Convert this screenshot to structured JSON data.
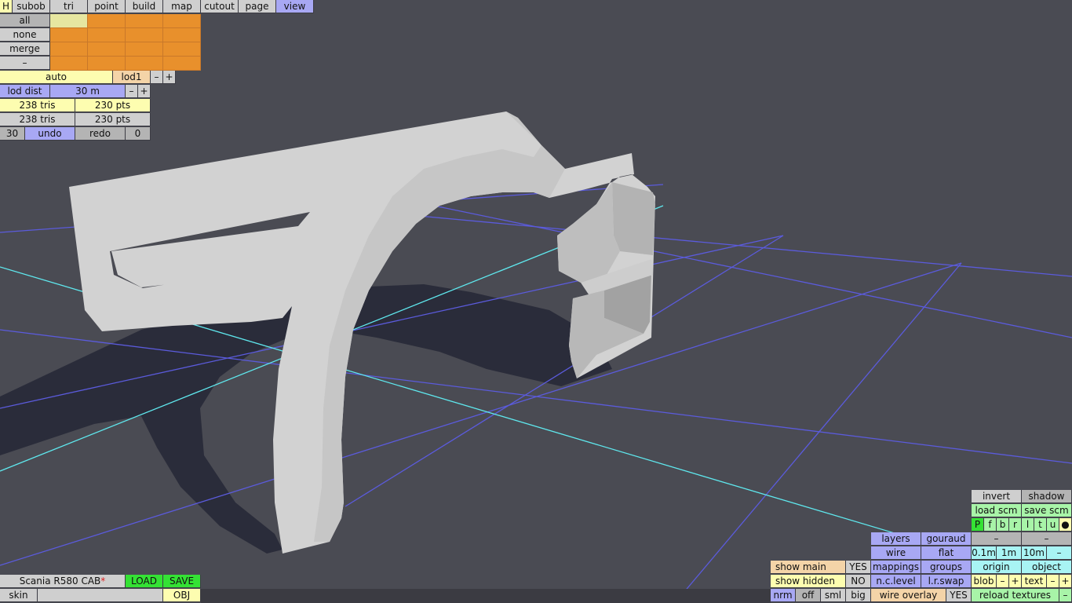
{
  "top_tabs": [
    "H",
    "subob",
    "tri",
    "point",
    "build",
    "map",
    "cutout",
    "page",
    "view"
  ],
  "select_rows": [
    "all",
    "none",
    "merge",
    "–"
  ],
  "lod": {
    "mode": "auto",
    "level": "lod1",
    "minus": "–",
    "plus": "+"
  },
  "lod_dist": {
    "label": "lod dist",
    "value": "30 m",
    "minus": "–",
    "plus": "+"
  },
  "stats": [
    {
      "tris": "238 tris",
      "pts": "230 pts"
    },
    {
      "tris": "238 tris",
      "pts": "230 pts"
    }
  ],
  "undo_row": {
    "count": "30",
    "undo": "undo",
    "redo": "redo",
    "redo_count": "0"
  },
  "file": {
    "name": "Scania R580 CAB",
    "modified_mark": "*",
    "load": "LOAD",
    "save": "SAVE",
    "skin": "skin",
    "obj": "OBJ"
  },
  "view_panel": {
    "invert": "invert",
    "shadow": "shadow",
    "load_scm": "load scm",
    "save_scm": "save scm",
    "channels": [
      "P",
      "f",
      "b",
      "r",
      "l",
      "t",
      "u",
      "●"
    ],
    "layers": "layers",
    "gouraud": "gouraud",
    "dash1": "–",
    "dash2": "–",
    "wire": "wire",
    "flat": "flat",
    "step1": "0.1m",
    "step2": "1m",
    "step3": "10m",
    "step_minus": "–",
    "show_main": "show main",
    "show_main_val": "YES",
    "mappings": "mappings",
    "groups": "groups",
    "origin": "origin",
    "object": "object",
    "show_hidden": "show hidden",
    "show_hidden_val": "NO",
    "nc_level": "n.c.level",
    "lr_swap": "l.r.swap",
    "blob": "blob",
    "blob_minus": "–",
    "blob_plus": "+",
    "text": "text",
    "text_minus": "–",
    "text_plus": "+",
    "nrm": "nrm",
    "off": "off",
    "sml": "sml",
    "big": "big",
    "wire_overlay": "wire overlay",
    "wire_overlay_val": "YES",
    "reload": "reload textures"
  }
}
